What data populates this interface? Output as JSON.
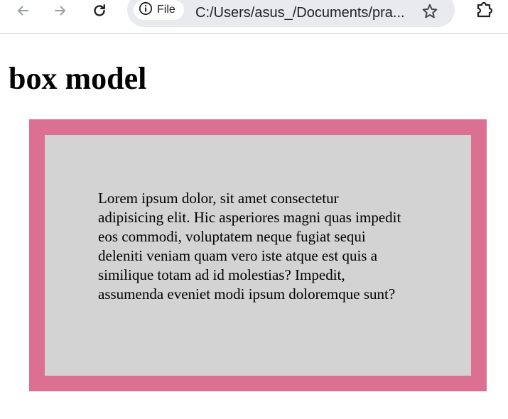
{
  "browser": {
    "chip_label": "File",
    "address": "C:/Users/asus_/Documents/pra...",
    "icons": {
      "back": "back-arrow-icon",
      "forward": "forward-arrow-icon",
      "reload": "reload-icon",
      "info": "info-icon",
      "bookmark": "star-icon",
      "extensions": "puzzle-piece-icon"
    }
  },
  "page": {
    "title": "box model",
    "paragraph": "Lorem ipsum dolor, sit amet consectetur adipisicing elit. Hic asperiores magni quas impedit eos commodi, voluptatem neque fugiat sequi deleniti veniam quam vero iste atque est quis a similique totam ad id molestias? Impedit, assumenda eveniet modi ipsum doloremque sunt?"
  },
  "colors": {
    "border": "#db7093",
    "content_background": "#d3d3d3",
    "omnibox": "#e8eaed"
  }
}
